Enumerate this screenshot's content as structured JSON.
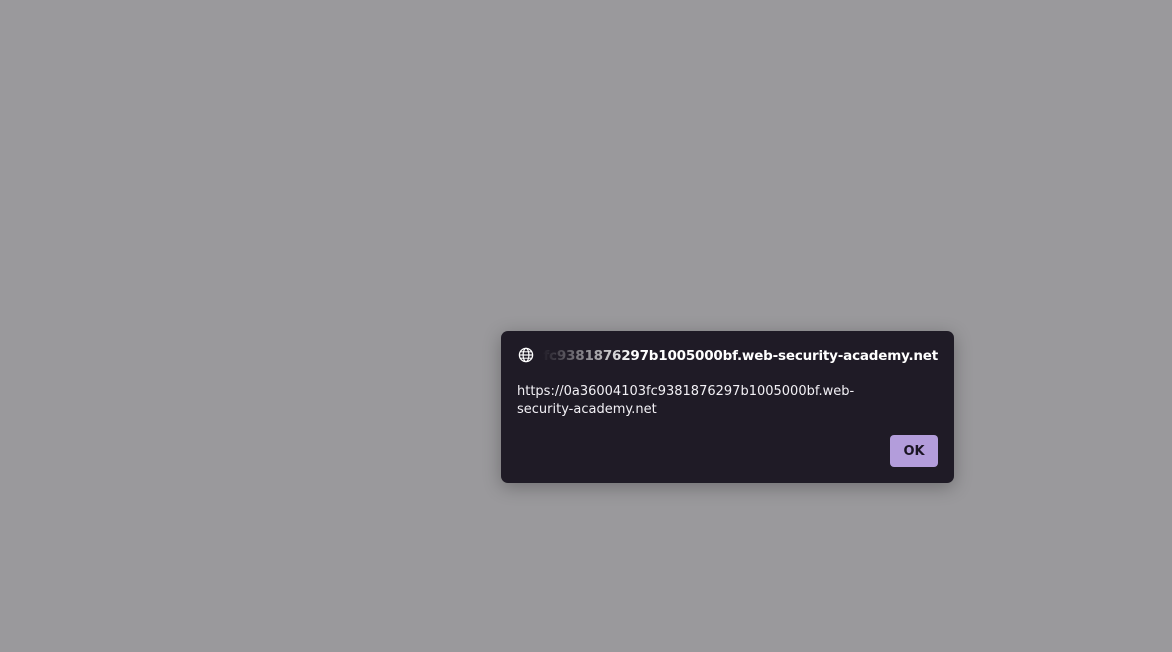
{
  "dialog": {
    "origin": "0a36004103fc9381876297b1005000bf.web-security-academy.net",
    "message": "https://0a36004103fc9381876297b1005000bf.web-security-academy.net",
    "ok_label": "OK",
    "globe_icon": "globe-icon"
  },
  "colors": {
    "backdrop": "#9a999c",
    "dialog_bg": "#1f1b26",
    "button_bg": "#b39ddb"
  }
}
